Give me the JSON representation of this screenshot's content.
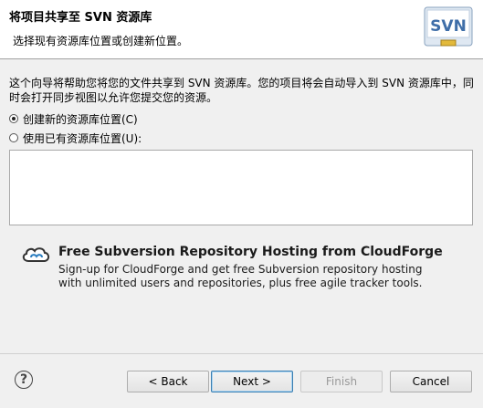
{
  "header": {
    "title": "将项目共享至 SVN 资源库",
    "subtitle": "选择现有资源库位置或创建新位置。",
    "logo_text": "SVN"
  },
  "description": "这个向导将帮助您将您的文件共享到 SVN 资源库。您的项目将会自动导入到 SVN 资源库中，同时会打开同步视图以允许您提交您的资源。",
  "options": {
    "create_new": "创建新的资源库位置(C)",
    "use_existing": "使用已有资源库位置(U):",
    "selected": "create_new"
  },
  "promo": {
    "title": "Free Subversion Repository Hosting from CloudForge",
    "text": "Sign-up for CloudForge and get free Subversion repository hosting with unlimited users and repositories, plus free agile tracker tools."
  },
  "buttons": {
    "help": "?",
    "back": "< Back",
    "next": "Next >",
    "finish": "Finish",
    "cancel": "Cancel"
  }
}
